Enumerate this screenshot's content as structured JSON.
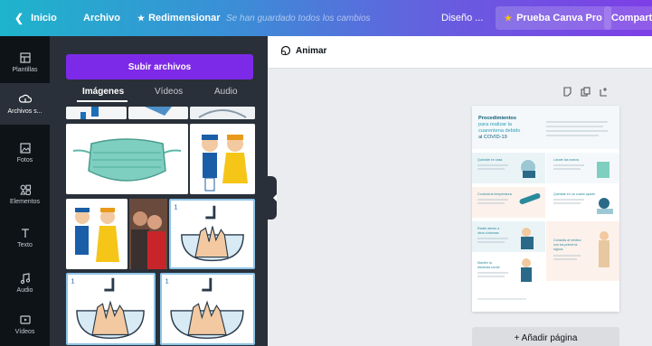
{
  "topbar": {
    "back_label": "Inicio",
    "file_label": "Archivo",
    "resize_label": "Redimensionar",
    "saved_status": "Se han guardado todos los cambios",
    "design_label": "Diseño ...",
    "pro_label": "Prueba Canva Pro",
    "share_label": "Comparti"
  },
  "sidebar": {
    "items": [
      {
        "label": "Plantillas",
        "icon": "templates-icon"
      },
      {
        "label": "Archivos s...",
        "icon": "uploads-icon"
      },
      {
        "label": "Fotos",
        "icon": "photos-icon"
      },
      {
        "label": "Elementos",
        "icon": "elements-icon"
      },
      {
        "label": "Texto",
        "icon": "text-icon"
      },
      {
        "label": "Audio",
        "icon": "audio-icon"
      },
      {
        "label": "Vídeos",
        "icon": "video-icon"
      }
    ]
  },
  "panel": {
    "upload_label": "Subir archivos",
    "tabs": [
      "Imágenes",
      "Vídeos",
      "Audio"
    ]
  },
  "editor": {
    "animate_label": "Animar",
    "add_page_label": "+ Añadir página"
  },
  "document": {
    "title": "Procedimientos para realizar la cuarentena debido al COVID-19",
    "sections": [
      "Quédate en casa",
      "Lávate las manos",
      "Controla la temperatura",
      "Quédate en un cuarto aparte",
      "Estate atento a otros síntomas",
      "Consulta al médico",
      "Mantén la distancia social"
    ]
  },
  "colors": {
    "accent": "#7d2ae8",
    "panel_bg": "#293039",
    "rail_bg": "#0e1318",
    "doc_accent": "#2a8a9c"
  }
}
